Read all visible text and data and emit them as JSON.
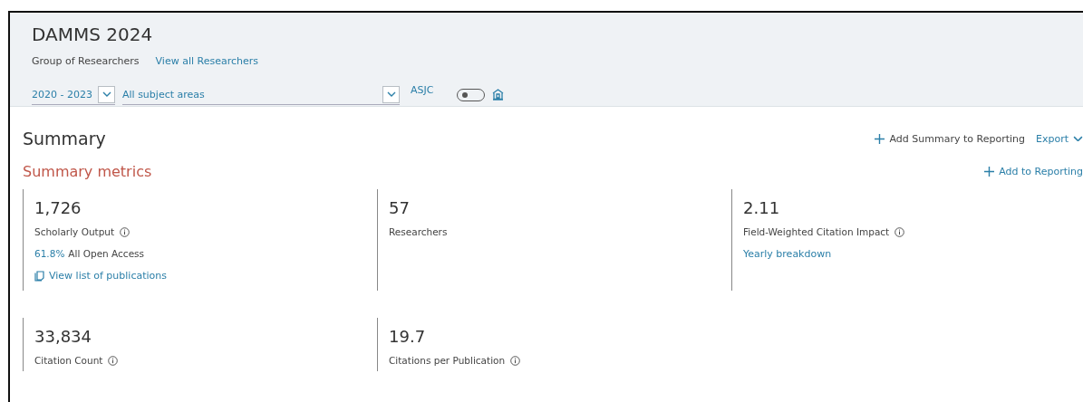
{
  "header": {
    "title": "DAMMS 2024",
    "subtitle": "Group of Researchers",
    "link": "View all Researchers",
    "filters": {
      "years": "2020 - 2023",
      "subject": "All subject areas",
      "classification": "ASJC",
      "toggle_on": false
    }
  },
  "summary": {
    "title": "Summary",
    "add_button": "Add Summary to Reporting",
    "export": "Export",
    "section_title": "Summary metrics",
    "section_add": "Add to Reporting",
    "metrics": [
      {
        "value": "1,726",
        "label": "Scholarly Output",
        "info": true,
        "share": "61.8%",
        "share_label": "All Open Access",
        "link": "View list of publications",
        "link_icon": true
      },
      {
        "value": "57",
        "label": "Researchers",
        "info": false
      },
      {
        "value": "2.11",
        "label": "Field-Weighted Citation Impact",
        "info": true,
        "link": "Yearly breakdown",
        "link_icon": false
      },
      {
        "value": "33,834",
        "label": "Citation Count",
        "info": true
      },
      {
        "value": "19.7",
        "label": "Citations per Publication",
        "info": true
      }
    ]
  }
}
